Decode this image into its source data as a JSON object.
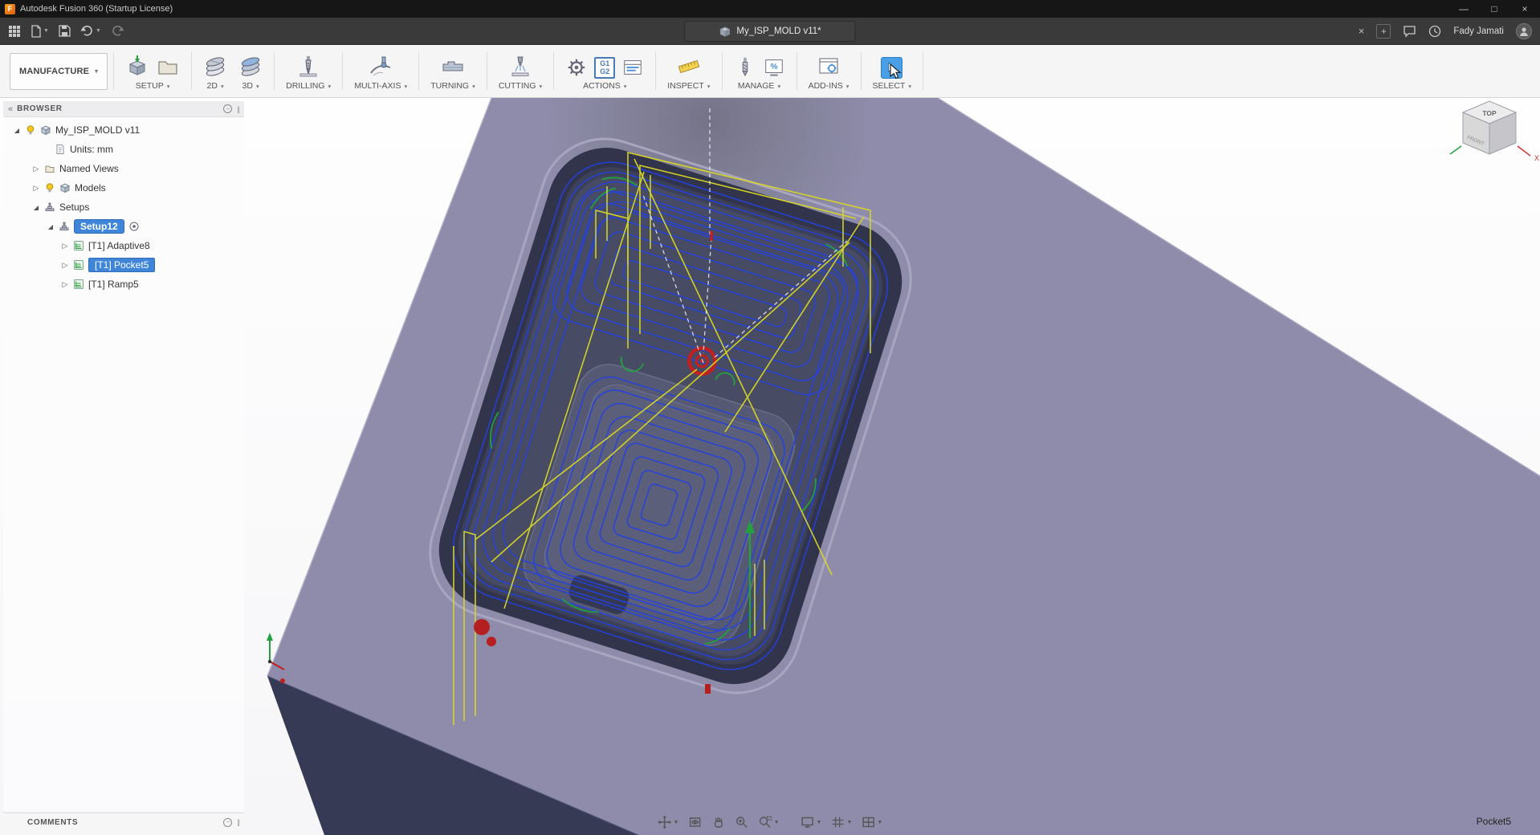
{
  "titlebar": {
    "title": "Autodesk Fusion 360 (Startup License)",
    "controls": {
      "minimize": "—",
      "maximize": "□",
      "close": "×"
    }
  },
  "appbar": {
    "document_tab": "My_ISP_MOLD v11*",
    "close_tab_glyph": "×",
    "new_tab_glyph": "+",
    "user": "Fady Jamati"
  },
  "ribbon": {
    "workspace": "MANUFACTURE",
    "items": [
      {
        "label": "SETUP"
      },
      {
        "label": "2D"
      },
      {
        "label": "3D"
      },
      {
        "label": "DRILLING"
      },
      {
        "label": "MULTI-AXIS"
      },
      {
        "label": "TURNING"
      },
      {
        "label": "CUTTING"
      },
      {
        "label": "ACTIONS"
      },
      {
        "label": "INSPECT"
      },
      {
        "label": "MANAGE"
      },
      {
        "label": "ADD-INS"
      },
      {
        "label": "SELECT"
      }
    ],
    "g1g2": [
      "G1",
      "G2"
    ],
    "percent_glyph": "%"
  },
  "browser": {
    "title": "BROWSER",
    "collapse_glyph": "«",
    "items": [
      {
        "label": "My_ISP_MOLD v11"
      },
      {
        "label": "Units: mm"
      },
      {
        "label": "Named Views"
      },
      {
        "label": "Models"
      },
      {
        "label": "Setups"
      },
      {
        "label": "Setup12"
      },
      {
        "label": "[T1] Adaptive8"
      },
      {
        "label": "[T1] Pocket5"
      },
      {
        "label": "[T1] Ramp5"
      }
    ]
  },
  "comments": {
    "title": "COMMENTS"
  },
  "viewport": {
    "viewcube": {
      "top": "TOP",
      "front": "FRONT",
      "axis_x": "X"
    },
    "status_label": "Pocket5"
  },
  "colors": {
    "selection_blue": "#3f86da",
    "toolpath_blue": "#2441e0",
    "rapid_yellow": "#d8d826",
    "lead_green": "#23a13f",
    "plunge_red": "#c21f1f",
    "part_top": "#8e8caa",
    "part_side": "#363a54"
  }
}
